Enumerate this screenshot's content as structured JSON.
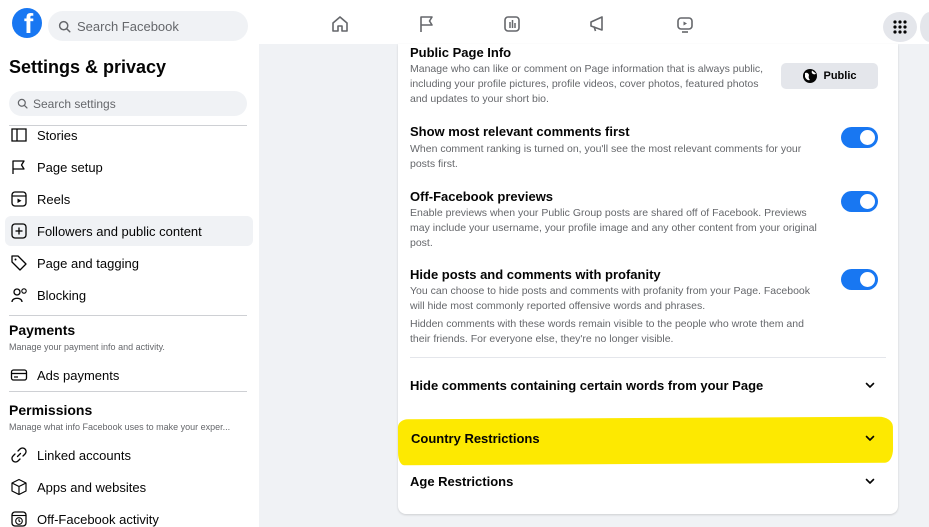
{
  "topbar": {
    "search_placeholder": "Search Facebook",
    "nav_icons": [
      "home-icon",
      "flag-icon",
      "video-icon",
      "megaphone-icon",
      "gaming-icon"
    ],
    "menu_icon": "grid-menu-icon"
  },
  "sidebar": {
    "title": "Settings & privacy",
    "search_placeholder": "Search settings",
    "items_top": [
      {
        "label": "Stories",
        "icon": "book-icon"
      },
      {
        "label": "Page setup",
        "icon": "flag-icon"
      },
      {
        "label": "Reels",
        "icon": "reels-icon"
      },
      {
        "label": "Followers and public content",
        "icon": "followers-icon",
        "active": true
      },
      {
        "label": "Page and tagging",
        "icon": "tag-icon"
      },
      {
        "label": "Blocking",
        "icon": "blocking-icon"
      }
    ],
    "payments": {
      "heading": "Payments",
      "subtitle": "Manage your payment info and activity.",
      "items": [
        {
          "label": "Ads payments",
          "icon": "card-icon"
        }
      ]
    },
    "permissions": {
      "heading": "Permissions",
      "subtitle": "Manage what info Facebook uses to make your exper...",
      "items": [
        {
          "label": "Linked accounts",
          "icon": "link-icon"
        },
        {
          "label": "Apps and websites",
          "icon": "cube-icon"
        },
        {
          "label": "Off-Facebook activity",
          "icon": "history-icon"
        }
      ]
    }
  },
  "content": {
    "public_page_info": {
      "title": "Public Page Info",
      "description": "Manage who can like or comment on Page information that is always public, including your profile pictures, profile videos, cover photos, featured photos and updates to your short bio.",
      "button_label": "Public"
    },
    "relevant_comments": {
      "title": "Show most relevant comments first",
      "description": "When comment ranking is turned on, you'll see the most relevant comments for your posts first.",
      "enabled": true
    },
    "off_facebook_previews": {
      "title": "Off-Facebook previews",
      "description": "Enable previews when your Public Group posts are shared off of Facebook. Previews may include your username, your profile image and any other content from your original post.",
      "enabled": true
    },
    "profanity": {
      "title": "Hide posts and comments with profanity",
      "description": "You can choose to hide posts and comments with profanity from your Page. Facebook will hide most commonly reported offensive words and phrases.",
      "description2": "Hidden comments with these words remain visible to the people who wrote them and their friends. For everyone else, they're no longer visible.",
      "enabled": true
    },
    "expand_rows": {
      "hide_words": "Hide comments containing certain words from your Page",
      "country": "Country Restrictions",
      "age": "Age Restrictions"
    },
    "highlight_color": "#fde901",
    "accent_color": "#1877f2"
  }
}
